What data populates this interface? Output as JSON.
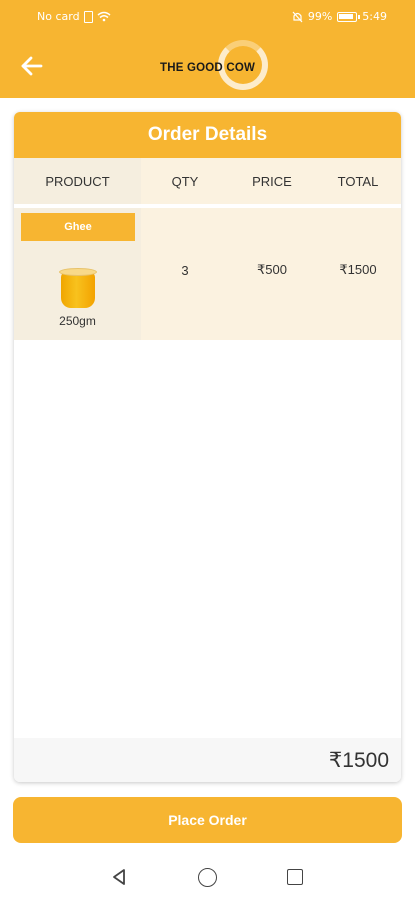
{
  "status_bar": {
    "carrier": "No card",
    "battery_percent": "99%",
    "time": "5:49"
  },
  "app_bar": {
    "back_icon": "arrow-left-icon",
    "logo_text": "THE GOOD COW"
  },
  "order": {
    "title": "Order Details",
    "columns": [
      "PRODUCT",
      "QTY",
      "PRICE",
      "TOTAL"
    ],
    "items": [
      {
        "name": "Ghee",
        "weight": "250gm",
        "qty": "3",
        "price": "₹500",
        "total": "₹1500"
      }
    ],
    "grand_total": "₹1500"
  },
  "actions": {
    "place_order_label": "Place Order"
  },
  "colors": {
    "accent": "#f7b531",
    "row_bg": "#fbf2e0"
  },
  "system_nav": {
    "back": "triangle-back-icon",
    "home": "circle-home-icon",
    "recent": "square-recents-icon"
  }
}
